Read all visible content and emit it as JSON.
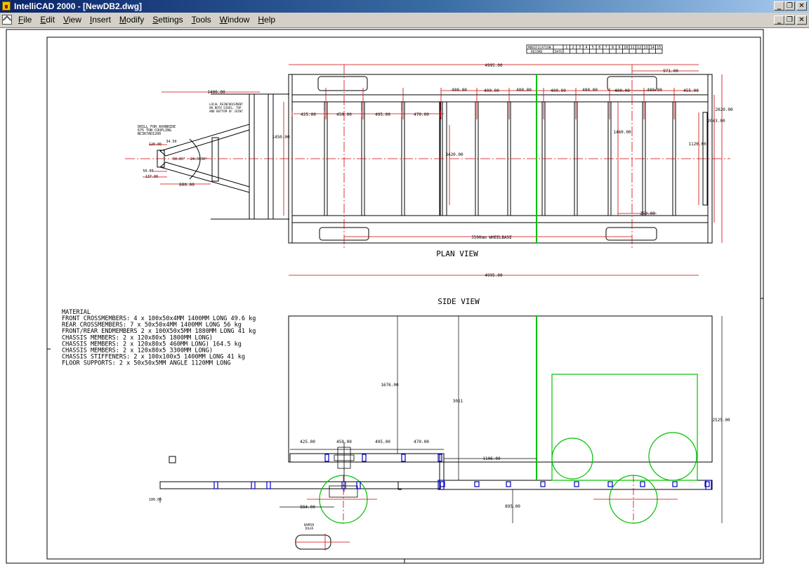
{
  "window": {
    "title": "IntelliCAD 2000 - [NewDB2.dwg]",
    "controls": {
      "minimize": "_",
      "restore": "❐",
      "close": "✕"
    }
  },
  "menu": {
    "items": [
      {
        "label": "File",
        "accel": "F",
        "rest": "ile"
      },
      {
        "label": "Edit",
        "accel": "E",
        "rest": "dit"
      },
      {
        "label": "View",
        "accel": "V",
        "rest": "iew"
      },
      {
        "label": "Insert",
        "accel": "I",
        "rest": "nsert"
      },
      {
        "label": "Modify",
        "accel": "M",
        "rest": "odify"
      },
      {
        "label": "Settings",
        "accel": "S",
        "rest": "ettings"
      },
      {
        "label": "Tools",
        "accel": "T",
        "rest": "ools"
      },
      {
        "label": "Window",
        "accel": "W",
        "rest": "indow"
      },
      {
        "label": "Help",
        "accel": "H",
        "rest": "elp"
      }
    ]
  },
  "drawing": {
    "colors": {
      "line": "#000000",
      "dimension": "#d00000",
      "green": "#00c000",
      "blue": "#0000c0"
    },
    "plan_view": {
      "label": "PLAN VIEW",
      "overall_length": "4995.00",
      "overall_length_bottom": "4995.00",
      "dims_top": [
        "400.00",
        "400.00",
        "400.00",
        "400.00",
        "400.00",
        "400.00",
        "400.00",
        "455.00"
      ],
      "dim_971": "971.00",
      "dims_front": [
        "425.00",
        "450.00",
        "495.00",
        "470.00"
      ],
      "wheelbase": "3500mm WHEELBASE",
      "width_outer": "2020.00",
      "width_inner": "2043.00",
      "dim_3420": "3420.00",
      "dim_1460": "1460.00",
      "dim_1450": "1450.00",
      "dim_1120": "1120.00",
      "dim_250": "250.00",
      "drawbar_length": "1400.00",
      "drawbar_600": "600.00",
      "drawbar_120": "120.00",
      "drawbar_34": "34.50",
      "drawbar_50": "50.00",
      "drawbar_137": "137.00",
      "drawbar_angle1": "50.00°",
      "drawbar_angle2": "24.0000°",
      "note_drill": [
        "DRILL FOR AVONRIDE",
        "675 TON COUPLING",
        "NC367ADI200"
      ],
      "note_reinf": [
        "LOCAL REINFORCEMENT",
        "ON BOTH SIDES, TOP",
        "AND BOTTOM OF JOINT"
      ]
    },
    "side_view": {
      "label": "SIDE VIEW",
      "dim_1676": "1676.00",
      "dim_3011": "3011",
      "dim_2525": "2525.00",
      "dims_front": [
        "425.00",
        "450.00",
        "495.00",
        "470.00"
      ],
      "dim_1106": "1106.00",
      "dim_884": "884.00",
      "dim_895": "895.00",
      "dim_100": "100.00",
      "small_note": [
        "DAMPER",
        "IDLER"
      ]
    },
    "material": {
      "heading": "MATERIAL",
      "lines": [
        "FRONT CROSSMEMBERS: 4 x 100x50x4MM 1400MM LONG  49.6 kg",
        "REAR CROSSMEMBERS: 7 x 50x50x4MM 1400MM LONG  56 kg",
        "FRONT/REAR ENDMEMBERS 2 x 100X50x5MM  1880MM LONG 41 kg",
        "CHASSIS MEMBERS: 2 x 120x80x5 1800MM LONG)",
        "CHASSIS MEMBERS: 2 x 120x80x5 460MM LONG)  164.5 kg",
        "CHASSIS MEMBERS: 2 x 120x80x5 3300MM LONG)",
        "CHASSIS STIFFENERS: 2 x 100x100x5 1400MM LONG 41 kg",
        "FLOOR SUPPORTS: 2 x 50x50x5MM ANGLE 1120MM LONG"
      ]
    },
    "revision_block": {
      "labels": [
        "MODIFICATION",
        "RECORD",
        "DATE"
      ],
      "numbers": [
        "1",
        "2",
        "3",
        "4",
        "5",
        "6",
        "7",
        "8",
        "9",
        "10",
        "11",
        "12",
        "13",
        "14",
        "15"
      ]
    }
  }
}
